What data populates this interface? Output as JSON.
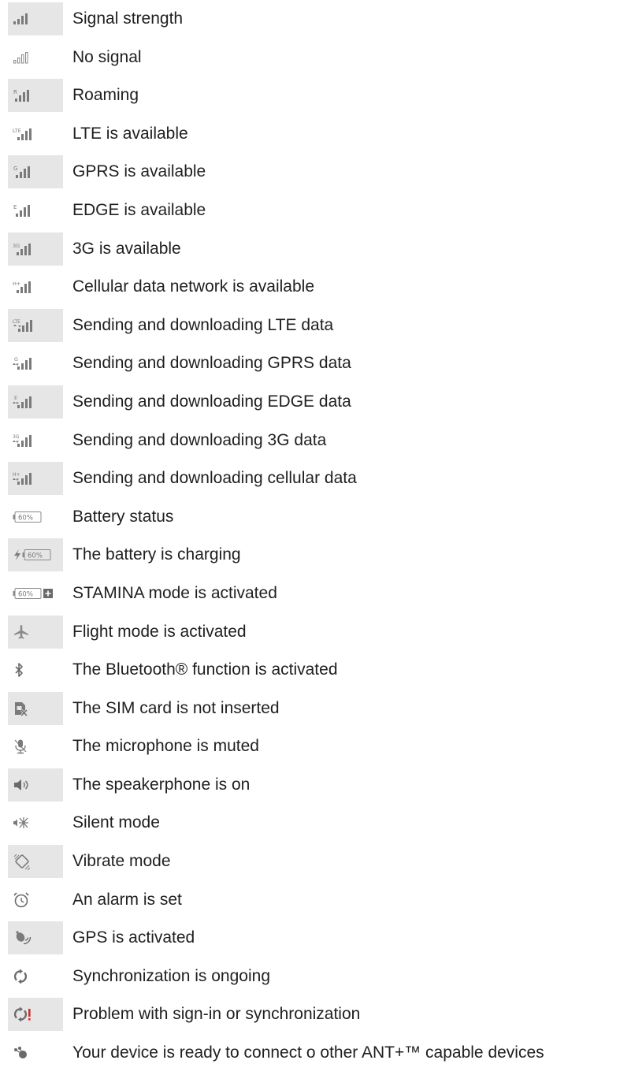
{
  "rows": [
    {
      "icon": "signal-strength-icon",
      "label": "Signal strength"
    },
    {
      "icon": "no-signal-icon",
      "label": "No signal"
    },
    {
      "icon": "roaming-icon",
      "label": "Roaming"
    },
    {
      "icon": "lte-icon",
      "label": "LTE is available"
    },
    {
      "icon": "gprs-icon",
      "label": "GPRS is available"
    },
    {
      "icon": "edge-icon",
      "label": "EDGE is available"
    },
    {
      "icon": "3g-icon",
      "label": "3G is available"
    },
    {
      "icon": "cellular-data-icon",
      "label": "Cellular data network is available"
    },
    {
      "icon": "lte-transfer-icon",
      "label": "Sending and downloading LTE data"
    },
    {
      "icon": "gprs-transfer-icon",
      "label": "Sending and downloading GPRS data"
    },
    {
      "icon": "edge-transfer-icon",
      "label": "Sending and downloading EDGE data"
    },
    {
      "icon": "3g-transfer-icon",
      "label": "Sending and downloading 3G data"
    },
    {
      "icon": "cellular-transfer-icon",
      "label": "Sending and downloading cellular data"
    },
    {
      "icon": "battery-status-icon",
      "label": "Battery status",
      "icon_text": "60%"
    },
    {
      "icon": "battery-charging-icon",
      "label": "The battery is charging",
      "icon_text": "60%"
    },
    {
      "icon": "stamina-mode-icon",
      "label": "STAMINA mode is activated",
      "icon_text": "60%"
    },
    {
      "icon": "flight-mode-icon",
      "label": "Flight mode is activated"
    },
    {
      "icon": "bluetooth-icon",
      "label": "The Bluetooth® function is activated"
    },
    {
      "icon": "sim-not-inserted-icon",
      "label": "The SIM card is not inserted"
    },
    {
      "icon": "microphone-muted-icon",
      "label": "The microphone is muted"
    },
    {
      "icon": "speakerphone-icon",
      "label": "The speakerphone is on"
    },
    {
      "icon": "silent-mode-icon",
      "label": "Silent mode"
    },
    {
      "icon": "vibrate-mode-icon",
      "label": "Vibrate mode"
    },
    {
      "icon": "alarm-icon",
      "label": "An alarm is set"
    },
    {
      "icon": "gps-icon",
      "label": "GPS is activated"
    },
    {
      "icon": "sync-icon",
      "label": "Synchronization is ongoing"
    },
    {
      "icon": "sync-problem-icon",
      "label": "Problem with sign-in or synchronization"
    },
    {
      "icon": "ant-plus-icon",
      "label": "Your device is ready to connect  o other ANT+™ capable devices"
    }
  ],
  "colors": {
    "icon_bg": "#e6e6e6",
    "icon_gray": "#7a7a7a",
    "alert_red": "#d22b2b"
  }
}
